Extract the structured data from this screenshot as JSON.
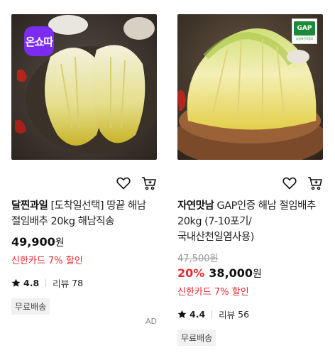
{
  "products": [
    {
      "badge": "온쇼따",
      "brand": "달찐과일",
      "title": "[도착일선택] 땅끝 해남 절임배추 20kg 해남직송",
      "original_price": "",
      "discount": "",
      "price": "49,900",
      "currency": "원",
      "card_promo": "신한카드 7% 할인",
      "rating": "4.8",
      "review_label": "리뷰",
      "review_count": "78",
      "shipping": "무료배송",
      "wishlist_icon": "heart-icon",
      "cart_icon": "cart-icon"
    },
    {
      "badge": "GAP",
      "badge_sub": "농림축산식품부",
      "brand": "자연맛남",
      "title": "GAP인증 해남 절임배추 20kg (7-10포기/국내산천일염사용)",
      "original_price": "47,500원",
      "discount": "20%",
      "price": "38,000",
      "currency": "원",
      "card_promo": "신한카드 7% 할인",
      "rating": "4.4",
      "review_label": "리뷰",
      "review_count": "56",
      "shipping": "무료배송",
      "wishlist_icon": "heart-icon",
      "cart_icon": "cart-icon"
    }
  ],
  "ad_label": "AD",
  "colors": {
    "discount": "#e8292e",
    "live_badge": "#7b2cf0",
    "gap_badge": "#1d8a3a"
  }
}
